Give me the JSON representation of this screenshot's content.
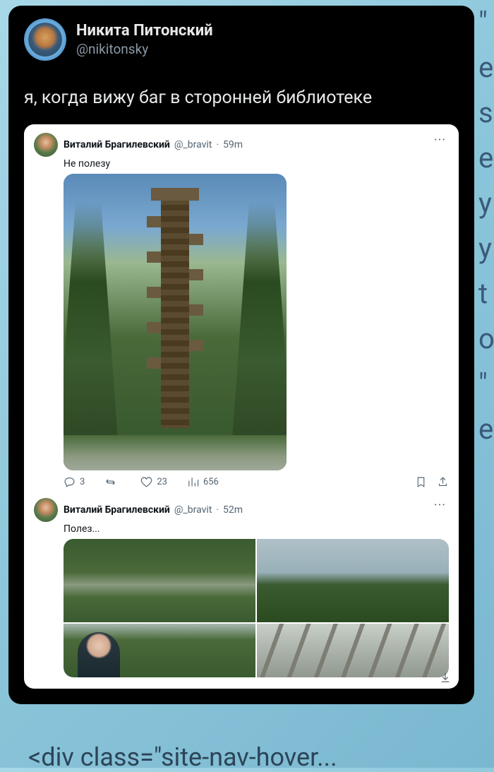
{
  "background": {
    "edge_fragments": "\" e s e y y t o \" e",
    "bottom_fragment": "<div class=\"site-nav-hover..."
  },
  "outer_tweet": {
    "author_name": "Никита Питонский",
    "author_handle": "@nikitonsky",
    "body": "я, когда вижу баг в сторонней библиотеке"
  },
  "quoted": [
    {
      "author_name": "Виталий Брагилевский",
      "author_handle": "@_bravit",
      "time": "59m",
      "body": "Не полезу",
      "replies": "3",
      "retweets": "",
      "likes": "23",
      "views": "656"
    },
    {
      "author_name": "Виталий Брагилевский",
      "author_handle": "@_bravit",
      "time": "52m",
      "body": "Полез..."
    }
  ],
  "labels": {
    "dot": "·",
    "more": "···"
  }
}
